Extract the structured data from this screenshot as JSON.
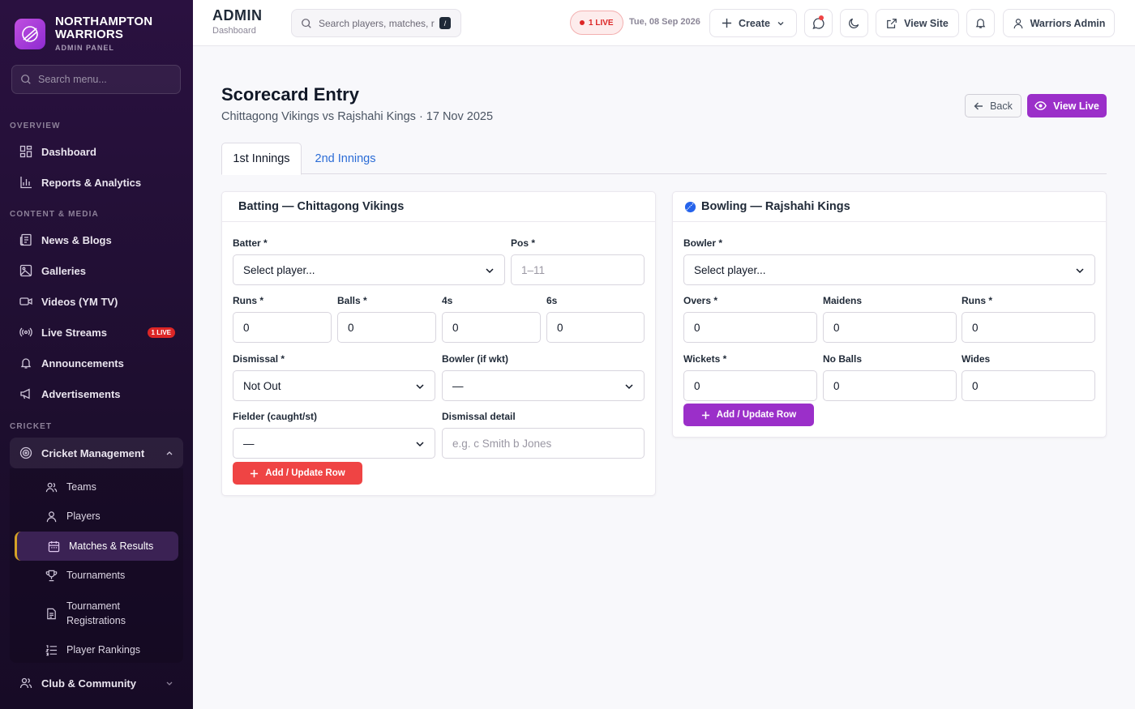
{
  "brand": {
    "line1": "NORTHAMPTON",
    "line2": "WARRIORS",
    "sub": "ADMIN PANEL"
  },
  "sidebar": {
    "search_placeholder": "Search menu...",
    "sections": {
      "overview": "OVERVIEW",
      "content": "CONTENT & MEDIA",
      "cricket": "CRICKET"
    },
    "items": [
      {
        "label": "Dashboard",
        "icon": "dashboard-icon"
      },
      {
        "label": "Reports & Analytics",
        "icon": "bar-chart-icon"
      },
      {
        "label": "News & Blogs",
        "icon": "newspaper-icon"
      },
      {
        "label": "Galleries",
        "icon": "image-icon"
      },
      {
        "label": "Videos (YM TV)",
        "icon": "video-icon"
      },
      {
        "label": "Live Streams",
        "icon": "broadcast-icon",
        "badge": "1 LIVE"
      },
      {
        "label": "Announcements",
        "icon": "bell-icon"
      },
      {
        "label": "Advertisements",
        "icon": "megaphone-icon"
      },
      {
        "label": "Cricket Management",
        "icon": "target-icon"
      },
      {
        "label": "Club & Community",
        "icon": "users-icon"
      }
    ],
    "cricket_sub": [
      {
        "label": "Teams",
        "icon": "users-icon"
      },
      {
        "label": "Players",
        "icon": "user-icon"
      },
      {
        "label": "Matches & Results",
        "icon": "calendar-icon"
      },
      {
        "label": "Tournaments",
        "icon": "trophy-icon"
      },
      {
        "label": "Tournament Registrations",
        "icon": "document-icon"
      },
      {
        "label": "Player Rankings",
        "icon": "list-ordered-icon"
      }
    ]
  },
  "topbar": {
    "title": "ADMIN",
    "subtitle": "Dashboard",
    "search_placeholder": "Search players, matches, r",
    "kbd": "/",
    "live": "1 LIVE",
    "date": "Tue, 08 Sep 2026",
    "create": "Create",
    "view_site": "View Site",
    "user": "Warriors Admin"
  },
  "page": {
    "title": "Scorecard Entry",
    "subtitle": "Chittagong Vikings vs Rajshahi Kings · 17 Nov 2025",
    "back": "Back",
    "view_live": "View Live",
    "tabs": [
      "1st Innings",
      "2nd Innings"
    ]
  },
  "batting": {
    "heading": "Batting — Chittagong Vikings",
    "batter_label": "Batter *",
    "batter_value": "Select player...",
    "pos_label": "Pos *",
    "pos_placeholder": "1–11",
    "runs_label": "Runs *",
    "runs": "0",
    "balls_label": "Balls *",
    "balls": "0",
    "fours_label": "4s",
    "fours": "0",
    "sixes_label": "6s",
    "sixes": "0",
    "dismissal_label": "Dismissal *",
    "dismissal": "Not Out",
    "bowler_label": "Bowler (if wkt)",
    "bowler": "—",
    "fielder_label": "Fielder (caught/st)",
    "fielder": "—",
    "detail_label": "Dismissal detail",
    "detail_placeholder": "e.g. c Smith b Jones",
    "add_button": "Add / Update Row"
  },
  "bowling": {
    "heading": "Bowling — Rajshahi Kings",
    "bowler_label": "Bowler *",
    "bowler_value": "Select player...",
    "overs_label": "Overs *",
    "overs": "0",
    "maidens_label": "Maidens",
    "maidens": "0",
    "runs_label": "Runs *",
    "runs": "0",
    "wickets_label": "Wickets *",
    "wickets": "0",
    "noballs_label": "No Balls",
    "noballs": "0",
    "wides_label": "Wides",
    "wides": "0",
    "add_button": "Add / Update Row"
  },
  "colors": {
    "accent": "#9b2fc9",
    "danger": "#ef4444",
    "link": "#2b6cd6",
    "sidebar": "#2a1140",
    "gold": "#d4a227"
  }
}
